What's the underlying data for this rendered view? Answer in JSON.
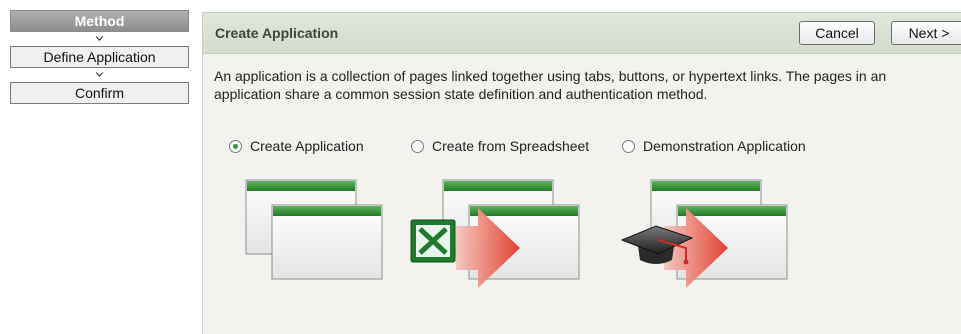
{
  "wizard": {
    "steps": [
      {
        "label": "Method",
        "active": true
      },
      {
        "label": "Define Application",
        "active": false
      },
      {
        "label": "Confirm",
        "active": false
      }
    ]
  },
  "panel": {
    "title": "Create Application",
    "cancel_label": "Cancel",
    "next_label": "Next >",
    "description": "An application is a collection of pages linked together using tabs, buttons, or hypertext links. The pages in an application share a common session state definition and authentication method."
  },
  "options": [
    {
      "label": "Create Application",
      "selected": true,
      "icon": "application-pages-icon"
    },
    {
      "label": "Create from Spreadsheet",
      "selected": false,
      "icon": "spreadsheet-import-icon"
    },
    {
      "label": "Demonstration Application",
      "selected": false,
      "icon": "demonstration-app-icon"
    }
  ],
  "colors": {
    "header_bg": "#d3dccf",
    "accent_green": "#2d8a2d",
    "active_step": "#9c9c9c",
    "arrow_red": "#e03a2a"
  }
}
